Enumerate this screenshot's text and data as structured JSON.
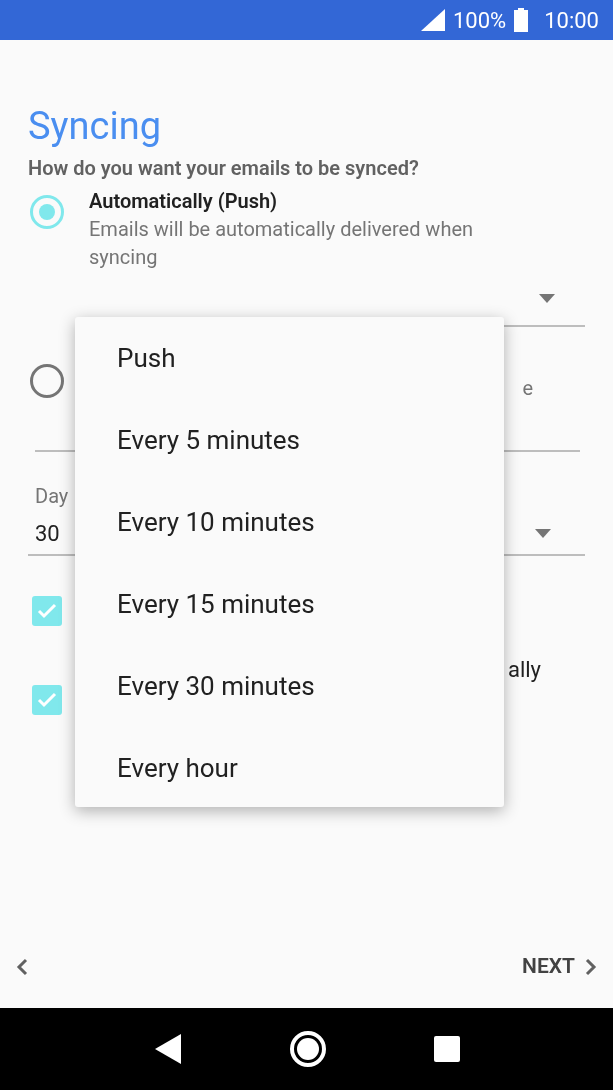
{
  "status_bar": {
    "battery": "100%",
    "time": "10:00"
  },
  "title": "Syncing",
  "question": "How do you want your emails to be synced?",
  "sync_options": [
    {
      "label": "Automatically (Push)",
      "description": "Emails will be automatically delivered when syncing",
      "selected": true
    },
    {
      "visible_text": "e",
      "selected": false
    }
  ],
  "days_field": {
    "label": "Day",
    "value": "30"
  },
  "checkboxes": [
    {
      "checked": true
    },
    {
      "visible_text": "ally",
      "checked": true
    }
  ],
  "dropdown_menu": {
    "items": [
      "Push",
      "Every 5 minutes",
      "Every 10 minutes",
      "Every 15 minutes",
      "Every 30 minutes",
      "Every hour"
    ]
  },
  "footer": {
    "next": "NEXT"
  }
}
